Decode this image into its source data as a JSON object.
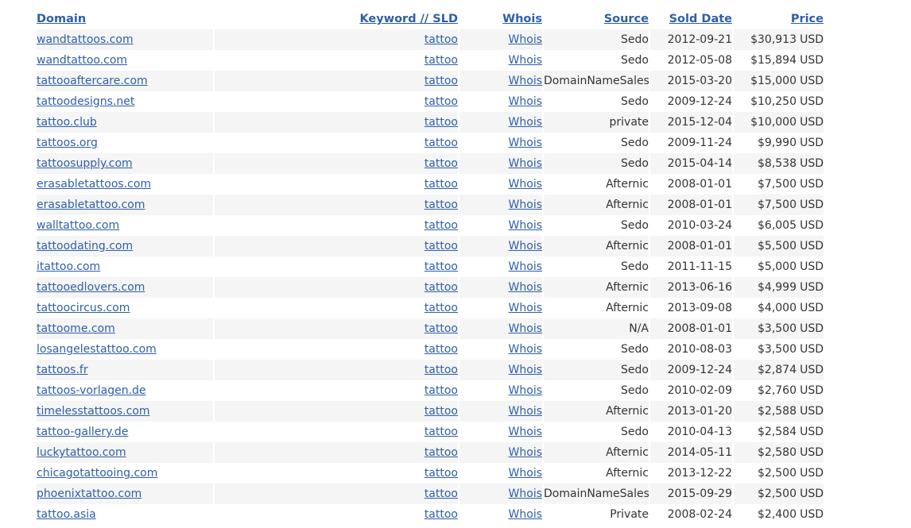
{
  "columns": {
    "domain": "Domain",
    "keyword": "Keyword // SLD",
    "whois": "Whois",
    "source": "Source",
    "sold_date": "Sold Date",
    "price": "Price"
  },
  "rows": [
    {
      "domain": "wandtattoos.com",
      "keyword": "tattoo",
      "whois": "Whois",
      "source": "Sedo",
      "date": "2012-09-21",
      "price": "$30,913",
      "currency": "USD"
    },
    {
      "domain": "wandtattoo.com",
      "keyword": "tattoo",
      "whois": "Whois",
      "source": "Sedo",
      "date": "2012-05-08",
      "price": "$15,894",
      "currency": "USD"
    },
    {
      "domain": "tattooaftercare.com",
      "keyword": "tattoo",
      "whois": "Whois",
      "source": "DomainNameSales",
      "date": "2015-03-20",
      "price": "$15,000",
      "currency": "USD"
    },
    {
      "domain": "tattoodesigns.net",
      "keyword": "tattoo",
      "whois": "Whois",
      "source": "Sedo",
      "date": "2009-12-24",
      "price": "$10,250",
      "currency": "USD"
    },
    {
      "domain": "tattoo.club",
      "keyword": "tattoo",
      "whois": "Whois",
      "source": "private",
      "date": "2015-12-04",
      "price": "$10,000",
      "currency": "USD"
    },
    {
      "domain": "tattoos.org",
      "keyword": "tattoo",
      "whois": "Whois",
      "source": "Sedo",
      "date": "2009-11-24",
      "price": "$9,990",
      "currency": "USD"
    },
    {
      "domain": "tattoosupply.com",
      "keyword": "tattoo",
      "whois": "Whois",
      "source": "Sedo",
      "date": "2015-04-14",
      "price": "$8,538",
      "currency": "USD"
    },
    {
      "domain": "erasabletattoos.com",
      "keyword": "tattoo",
      "whois": "Whois",
      "source": "Afternic",
      "date": "2008-01-01",
      "price": "$7,500",
      "currency": "USD"
    },
    {
      "domain": "erasabletattoo.com",
      "keyword": "tattoo",
      "whois": "Whois",
      "source": "Afternic",
      "date": "2008-01-01",
      "price": "$7,500",
      "currency": "USD"
    },
    {
      "domain": "walltattoo.com",
      "keyword": "tattoo",
      "whois": "Whois",
      "source": "Sedo",
      "date": "2010-03-24",
      "price": "$6,005",
      "currency": "USD"
    },
    {
      "domain": "tattoodating.com",
      "keyword": "tattoo",
      "whois": "Whois",
      "source": "Afternic",
      "date": "2008-01-01",
      "price": "$5,500",
      "currency": "USD"
    },
    {
      "domain": "itattoo.com",
      "keyword": "tattoo",
      "whois": "Whois",
      "source": "Sedo",
      "date": "2011-11-15",
      "price": "$5,000",
      "currency": "USD"
    },
    {
      "domain": "tattooedlovers.com",
      "keyword": "tattoo",
      "whois": "Whois",
      "source": "Afternic",
      "date": "2013-06-16",
      "price": "$4,999",
      "currency": "USD"
    },
    {
      "domain": "tattoocircus.com",
      "keyword": "tattoo",
      "whois": "Whois",
      "source": "Afternic",
      "date": "2013-09-08",
      "price": "$4,000",
      "currency": "USD"
    },
    {
      "domain": "tattoome.com",
      "keyword": "tattoo",
      "whois": "Whois",
      "source": "N/A",
      "date": "2008-01-01",
      "price": "$3,500",
      "currency": "USD"
    },
    {
      "domain": "losangelestattoo.com",
      "keyword": "tattoo",
      "whois": "Whois",
      "source": "Sedo",
      "date": "2010-08-03",
      "price": "$3,500",
      "currency": "USD"
    },
    {
      "domain": "tattoos.fr",
      "keyword": "tattoo",
      "whois": "Whois",
      "source": "Sedo",
      "date": "2009-12-24",
      "price": "$2,874",
      "currency": "USD"
    },
    {
      "domain": "tattoos-vorlagen.de",
      "keyword": "tattoo",
      "whois": "Whois",
      "source": "Sedo",
      "date": "2010-02-09",
      "price": "$2,760",
      "currency": "USD"
    },
    {
      "domain": "timelesstattoos.com",
      "keyword": "tattoo",
      "whois": "Whois",
      "source": "Afternic",
      "date": "2013-01-20",
      "price": "$2,588",
      "currency": "USD"
    },
    {
      "domain": "tattoo-gallery.de",
      "keyword": "tattoo",
      "whois": "Whois",
      "source": "Sedo",
      "date": "2010-04-13",
      "price": "$2,584",
      "currency": "USD"
    },
    {
      "domain": "luckytattoo.com",
      "keyword": "tattoo",
      "whois": "Whois",
      "source": "Afternic",
      "date": "2014-05-11",
      "price": "$2,580",
      "currency": "USD"
    },
    {
      "domain": "chicagotattooing.com",
      "keyword": "tattoo",
      "whois": "Whois",
      "source": "Afternic",
      "date": "2013-12-22",
      "price": "$2,500",
      "currency": "USD"
    },
    {
      "domain": "phoenixtattoo.com",
      "keyword": "tattoo",
      "whois": "Whois",
      "source": "DomainNameSales",
      "date": "2015-09-29",
      "price": "$2,500",
      "currency": "USD"
    },
    {
      "domain": "tattoo.asia",
      "keyword": "tattoo",
      "whois": "Whois",
      "source": "Private",
      "date": "2008-02-24",
      "price": "$2,400",
      "currency": "USD"
    }
  ],
  "colors": {
    "link": "#2e5fa8",
    "stripe": "#f5f5f5",
    "text": "#333333"
  }
}
